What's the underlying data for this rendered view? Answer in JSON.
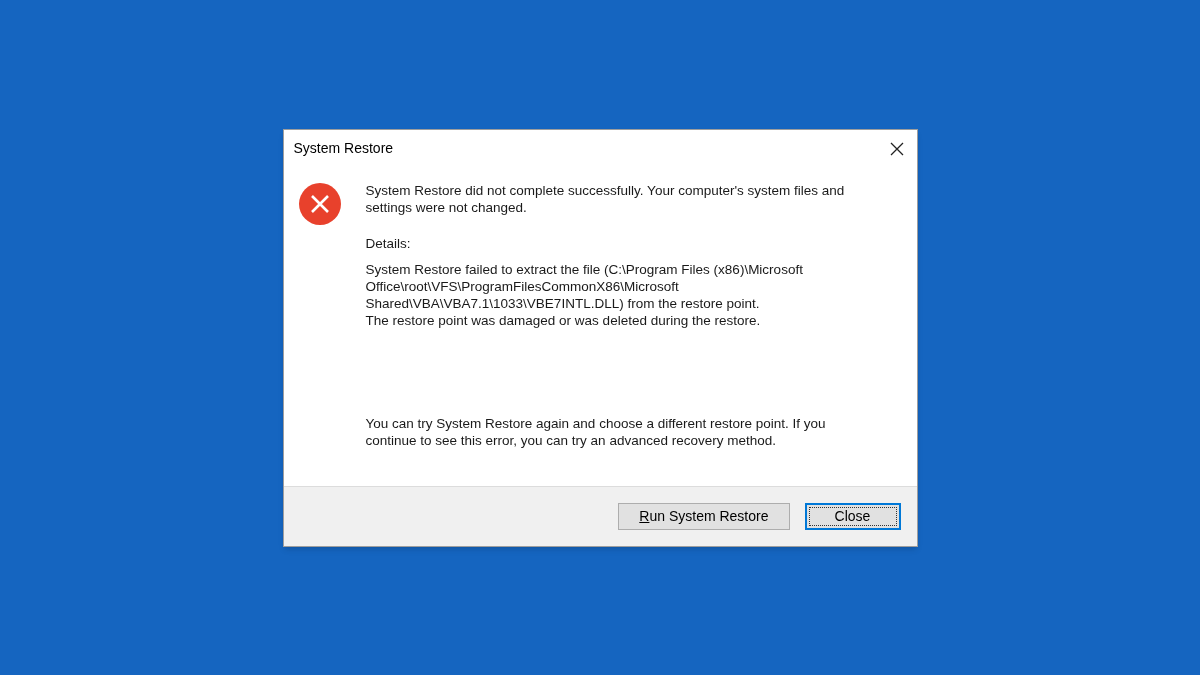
{
  "dialog": {
    "title": "System Restore",
    "message_lines": [
      "System Restore did not complete successfully. Your computer's system files and",
      "settings were not changed."
    ],
    "details_label": "Details:",
    "details_lines": [
      "System Restore failed to extract the file (C:\\Program Files (x86)\\Microsoft",
      "Office\\root\\VFS\\ProgramFilesCommonX86\\Microsoft",
      "Shared\\VBA\\VBA7.1\\1033\\VBE7INTL.DLL) from the restore point.",
      "The restore point was damaged or was deleted during the restore."
    ],
    "hint_lines": [
      "You can try System Restore again and choose a different restore point. If you",
      "continue to see this error, you can try an advanced recovery method."
    ],
    "buttons": [
      {
        "label": "Run System Restore",
        "access_key_underlined": true,
        "default": false
      },
      {
        "label": "Close",
        "access_key_underlined": false,
        "default": true
      }
    ]
  }
}
